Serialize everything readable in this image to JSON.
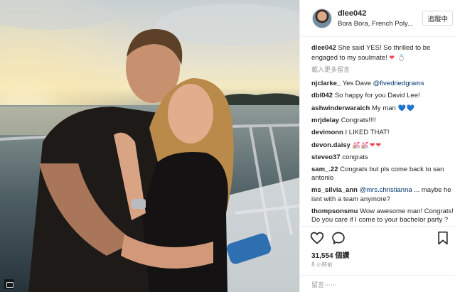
{
  "post": {
    "username": "dlee042",
    "location": "Bora Bora, French Poly...",
    "follow_label": "追蹤中",
    "caption": {
      "username": "dlee042",
      "text": "She said YES! So thrilled to be engaged to my soulmate!",
      "emoji": "❤ 💍"
    },
    "load_more_label": "載入更多留言",
    "comments": [
      {
        "username": "njclarke_",
        "text": "Yes Dave",
        "mention": "@fivedriedgrams",
        "after": "",
        "emoji": ""
      },
      {
        "username": "dbl042",
        "text": "So happy for you David Lee!",
        "mention": "",
        "after": "",
        "emoji": ""
      },
      {
        "username": "ashwinderwaraich",
        "text": "My man",
        "mention": "",
        "after": "",
        "emoji": "💙💙"
      },
      {
        "username": "mrjdelay",
        "text": "Congrats!!!!",
        "mention": "",
        "after": "",
        "emoji": ""
      },
      {
        "username": "devimonn",
        "text": "I LIKED THAT!",
        "mention": "",
        "after": "",
        "emoji": ""
      },
      {
        "username": "devon.daisy",
        "text": "",
        "mention": "",
        "after": "",
        "emoji": "💒💒❤❤"
      },
      {
        "username": "steveo37",
        "text": "congrats",
        "mention": "",
        "after": "",
        "emoji": ""
      },
      {
        "username": "sam_.22",
        "text": "Congrats but pls come back to san antonio",
        "mention": "",
        "after": "",
        "emoji": ""
      },
      {
        "username": "ms_silvia_ann",
        "text": "",
        "mention": "@mrs.christianna",
        "after": "... maybe he isnt with a team anymore?",
        "emoji": ""
      },
      {
        "username": "thompsonsmu",
        "text": "Wow awesome man! Congrats! Do you care if I come to your bachelor party ?",
        "mention": "",
        "after": "",
        "emoji": ""
      }
    ],
    "likes_count": "31,554",
    "likes_label": "個讚",
    "time_ago": "8 小時前",
    "add_comment_placeholder": "留言⋯⋯",
    "icons": {
      "like": "heart-outline-icon",
      "comment": "speech-bubble-icon",
      "save": "bookmark-icon",
      "photo_corner": "image-badge-icon"
    },
    "colors": {
      "mention": "#003569",
      "muted": "#999999",
      "heart": "#ed4956",
      "blue_heart": "#3897f0"
    }
  }
}
